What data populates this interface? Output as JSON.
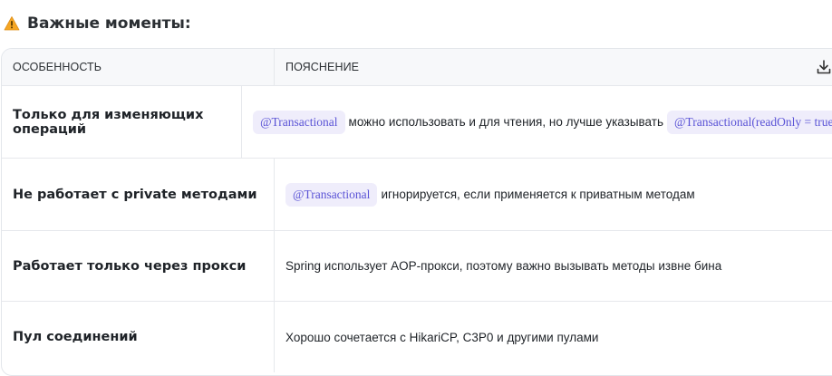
{
  "heading": {
    "icon": "warning-icon",
    "text": "Важные моменты:"
  },
  "table": {
    "columns": [
      "ОСОБЕННОСТЬ",
      "ПОЯСНЕНИЕ"
    ],
    "download_icon": "download-icon",
    "rows": [
      {
        "feature": "Только для изменяющих операций",
        "code1": "@Transactional",
        "text": "можно использовать и для чтения, но лучше указывать",
        "code2": "@Transactional(readOnly = true)"
      },
      {
        "feature": "Не работает с private методами",
        "code1": "@Transactional",
        "text": "игнорируется, если применяется к приватным методам"
      },
      {
        "feature": "Работает только через прокси",
        "text": "Spring использует AOP-прокси, поэтому важно вызывать методы извне бина"
      },
      {
        "feature": "Пул соединений",
        "text": "Хорошо сочетается с HikariCP, C3P0 и другими пулами"
      }
    ]
  },
  "colors": {
    "code_bg": "#efedfb",
    "code_text": "#5b54d6",
    "warning": "#f5a623"
  }
}
